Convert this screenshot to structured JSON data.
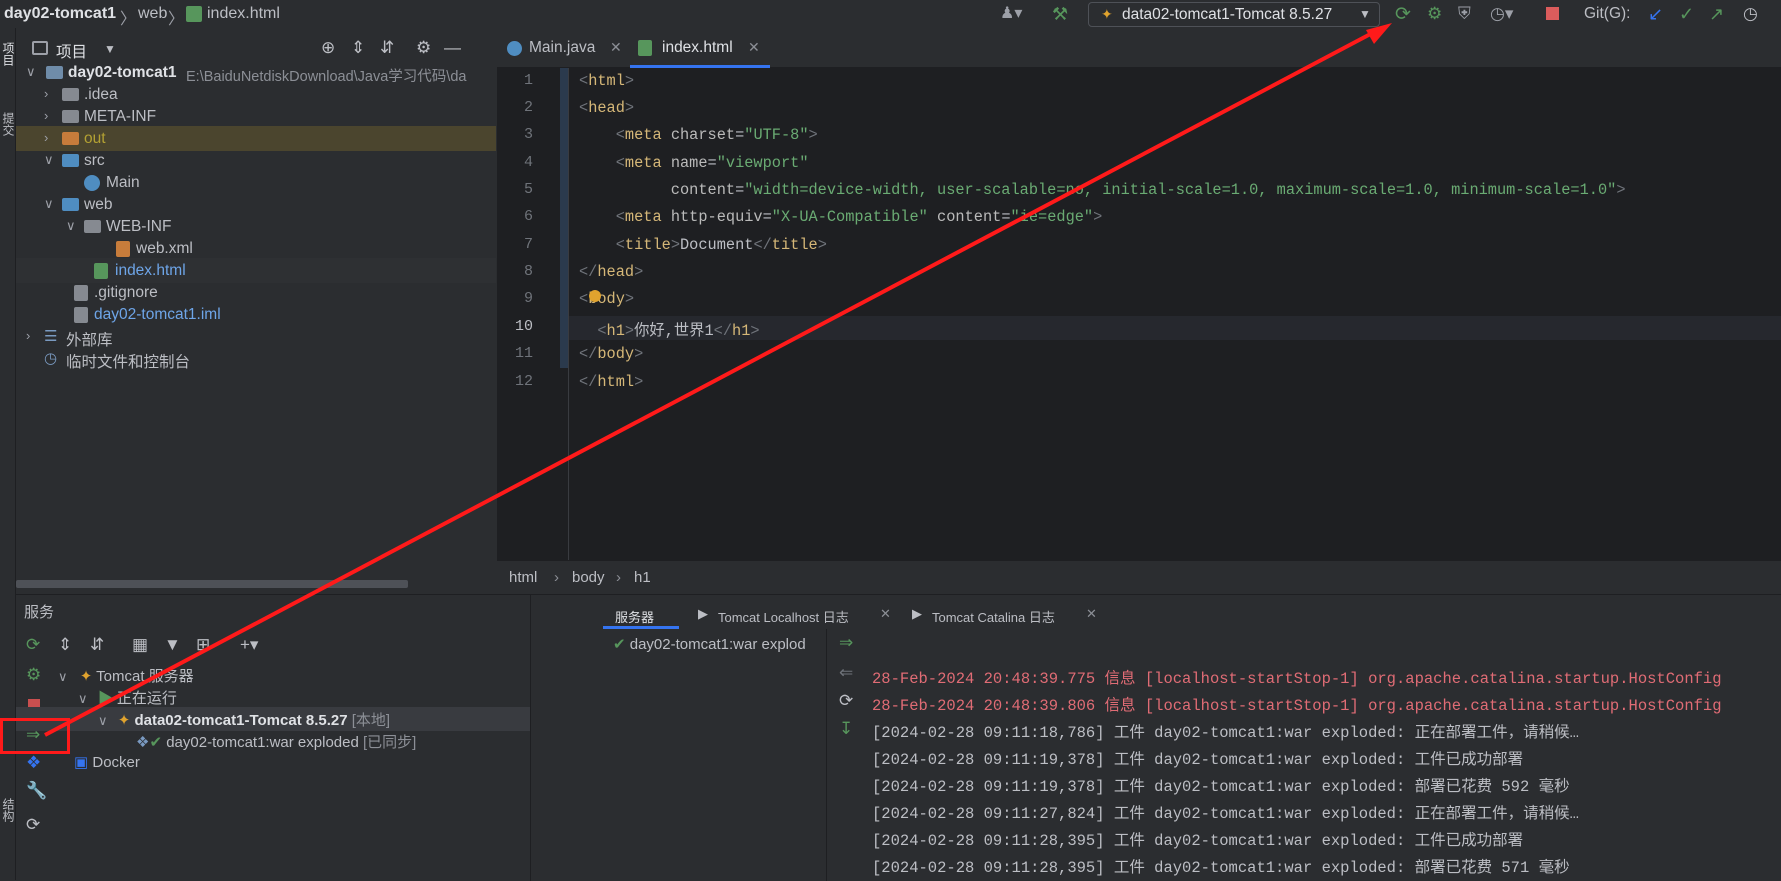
{
  "breadcrumb": {
    "project": "day02-tomcat1",
    "folder": "web",
    "file": "index.html"
  },
  "run_config": "data02-tomcat1-Tomcat 8.5.27",
  "git_label": "Git(G):",
  "project_panel": {
    "title": "项目",
    "tree": [
      {
        "label": "day02-tomcat1",
        "path": "E:\\BaiduNetdiskDownload\\Java学习代码\\da"
      },
      {
        "label": ".idea"
      },
      {
        "label": "META-INF"
      },
      {
        "label": "out"
      },
      {
        "label": "src"
      },
      {
        "label": "Main"
      },
      {
        "label": "web"
      },
      {
        "label": "WEB-INF"
      },
      {
        "label": "web.xml"
      },
      {
        "label": "index.html"
      },
      {
        "label": ".gitignore"
      },
      {
        "label": "day02-tomcat1.iml"
      },
      {
        "label": "外部库"
      },
      {
        "label": "临时文件和控制台"
      }
    ]
  },
  "left_strip": {
    "top": "项目",
    "mid": "提交",
    "bottom": "结构"
  },
  "editor": {
    "tabs": [
      "Main.java",
      "index.html"
    ],
    "lines": [
      "1",
      "2",
      "3",
      "4",
      "5",
      "6",
      "7",
      "8",
      "9",
      "10",
      "11",
      "12"
    ],
    "code": {
      "l3_charset": "\"UTF-8\"",
      "l4_name": "\"viewport\"",
      "l5_content": "\"width=device-width, user-scalable=no, initial-scale=1.0, maximum-scale=1.0, minimum-scale=1.0\"",
      "l6_equiv": "\"X-UA-Compatible\"",
      "l6_content": "\"ie=edge\"",
      "l7_title": "Document",
      "l10_h1": "你好,世界1"
    },
    "status_breadcrumb": [
      "html",
      "body",
      "h1"
    ]
  },
  "services": {
    "title": "服务",
    "tree": [
      {
        "label": "Tomcat 服务器"
      },
      {
        "label": "正在运行"
      },
      {
        "label": "data02-tomcat1-Tomcat 8.5.27",
        "suffix": "[本地]"
      },
      {
        "label": "day02-tomcat1:war exploded",
        "suffix": "[已同步]"
      },
      {
        "label": "Docker"
      }
    ],
    "log_tabs": [
      "服务器",
      "Tomcat Localhost 日志",
      "Tomcat Catalina 日志"
    ],
    "deploy_item": "day02-tomcat1:war explod",
    "log_lines": [
      "28-Feb-2024 20:48:39.775 信息 [localhost-startStop-1] org.apache.catalina.startup.HostConfig",
      "28-Feb-2024 20:48:39.806 信息 [localhost-startStop-1] org.apache.catalina.startup.HostConfig",
      "[2024-02-28 09:11:18,786] 工件 day02-tomcat1:war exploded: 正在部署工件，请稍候…",
      "[2024-02-28 09:11:19,378] 工件 day02-tomcat1:war exploded: 工件已成功部署",
      "[2024-02-28 09:11:19,378] 工件 day02-tomcat1:war exploded: 部署已花费 592 毫秒",
      "[2024-02-28 09:11:27,824] 工件 day02-tomcat1:war exploded: 正在部署工件，请稍候…",
      "[2024-02-28 09:11:28,395] 工件 day02-tomcat1:war exploded: 工件已成功部署",
      "[2024-02-28 09:11:28,395] 工件 day02-tomcat1:war exploded: 部署已花费 571 毫秒"
    ]
  },
  "colors": {
    "annotation": "#ff1a1a",
    "accent": "#3574f0",
    "green": "#57965c"
  }
}
